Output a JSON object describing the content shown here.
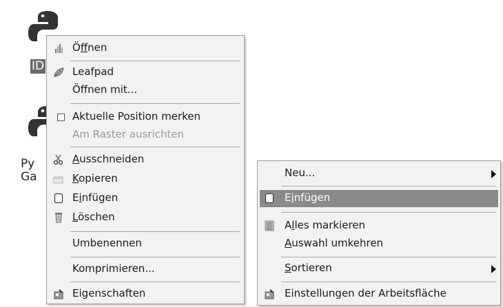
{
  "desktop": {
    "icon1_label": "ID",
    "icon2_label_line1": "Py",
    "icon2_label_line2": "Ga"
  },
  "context_menu_file": {
    "items": {
      "open": {
        "pre": "Ö",
        "acc": "f",
        "post": "fnen",
        "icon": "application-icon"
      },
      "leafpad": {
        "label": "Leafpad",
        "icon": "leafpad-icon"
      },
      "open_with": {
        "label": "Öffnen mit..."
      },
      "remember_position": {
        "label": "Aktuelle Position merken",
        "icon": "checkbox-icon"
      },
      "snap_to_grid": {
        "label": "Am Raster ausrichten",
        "disabled": true
      },
      "cut": {
        "pre": "",
        "acc": "A",
        "post": "usschneiden",
        "icon": "scissors-icon"
      },
      "copy": {
        "pre": "",
        "acc": "K",
        "post": "opieren",
        "icon": "copy-icon"
      },
      "paste": {
        "pre": "E",
        "acc": "i",
        "post": "nfügen",
        "icon": "paste-icon"
      },
      "delete": {
        "pre": "",
        "acc": "L",
        "post": "öschen",
        "icon": "trash-icon"
      },
      "rename": {
        "label": "Umbenennen"
      },
      "compress": {
        "label": "Komprimieren..."
      },
      "properties": {
        "pre": "Ei",
        "acc": "g",
        "post": "enschaften",
        "icon": "properties-icon"
      }
    }
  },
  "context_menu_desktop": {
    "items": {
      "new": {
        "label": "Neu..."
      },
      "paste": {
        "pre": "E",
        "acc": "i",
        "post": "nfügen",
        "icon": "paste-icon",
        "highlighted": true
      },
      "select_all": {
        "pre": "A",
        "acc": "l",
        "post": "les markieren",
        "icon": "select-all-icon"
      },
      "invert_selection": {
        "pre": "",
        "acc": "A",
        "post": "uswahl umkehren"
      },
      "sort": {
        "pre": "",
        "acc": "S",
        "post": "ortieren"
      },
      "desktop_settings": {
        "label": "Einstellungen der Arbeitsfläche",
        "icon": "properties-icon"
      }
    }
  },
  "colors": {
    "menu_bg": "#f2f2f2",
    "highlight": "#8a8a8a",
    "disabled_text": "#9a9a9a"
  }
}
